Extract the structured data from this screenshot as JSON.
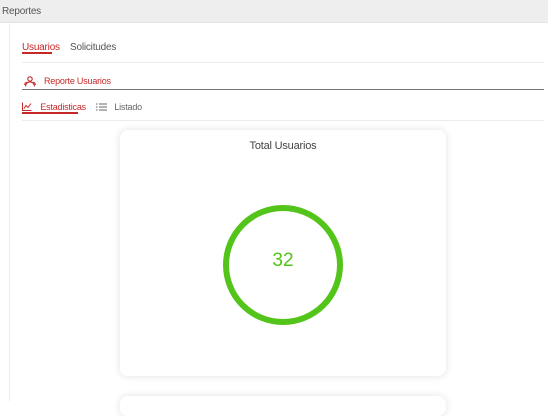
{
  "window": {
    "title": "Reportes"
  },
  "main_tabs": [
    {
      "label": "Usuarios",
      "active": true
    },
    {
      "label": "Solicitudes",
      "active": false
    }
  ],
  "report": {
    "label": "Reporte Usuarios",
    "icon": "users-icon"
  },
  "sub_tabs": [
    {
      "label": "Estadisticas",
      "icon": "chart-icon",
      "active": true
    },
    {
      "label": "Listado",
      "icon": "list-icon",
      "active": false
    }
  ],
  "card": {
    "title": "Total Usuarios",
    "value": "32",
    "ring_color": "#52c41a"
  },
  "colors": {
    "accent": "#c62828",
    "success": "#52c41a"
  }
}
